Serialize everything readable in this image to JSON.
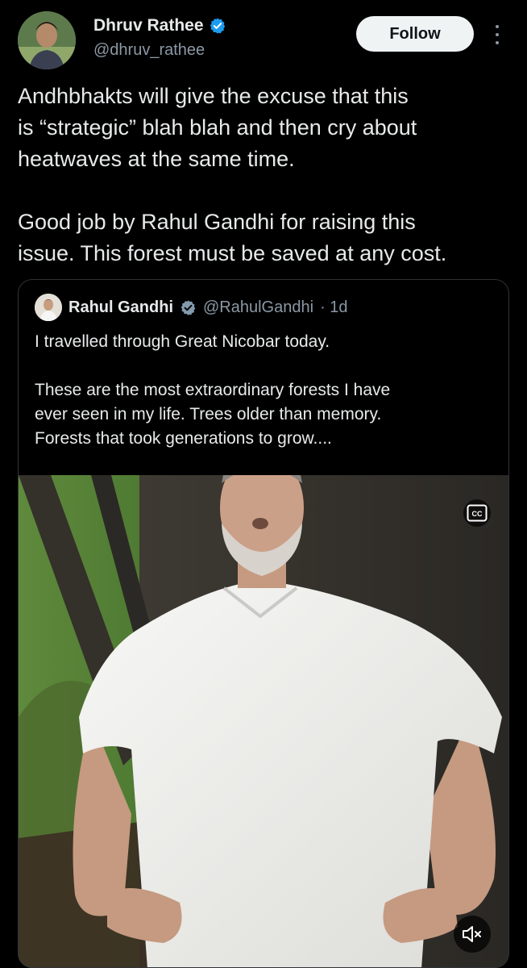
{
  "author": {
    "name": "Dhruv Rathee",
    "handle": "@dhruv_rathee",
    "verified_color": "#1d9bf0"
  },
  "follow_label": "Follow",
  "post_text": "Andhbhakts will give the excuse that this\nis “strategic” blah blah and then cry about\nheatwaves at the same time.\n\nGood job by Rahul Gandhi for raising this\nissue. This forest must be saved at any cost.",
  "quoted": {
    "name": "Rahul Gandhi",
    "handle": "@RahulGandhi",
    "time": "· 1d",
    "text": "I travelled through Great Nicobar today.\n\nThese are the most extraordinary forests I have\never seen in my life. Trees older than memory.\nForests that took generations to grow....",
    "verified_color": "#829aab"
  },
  "media": {
    "type": "video",
    "cc_label": "CC",
    "muted": true
  },
  "colors": {
    "background": "#000000",
    "text": "#e7e9ea",
    "secondary_text": "#8b98a5",
    "border": "#2f3336"
  }
}
